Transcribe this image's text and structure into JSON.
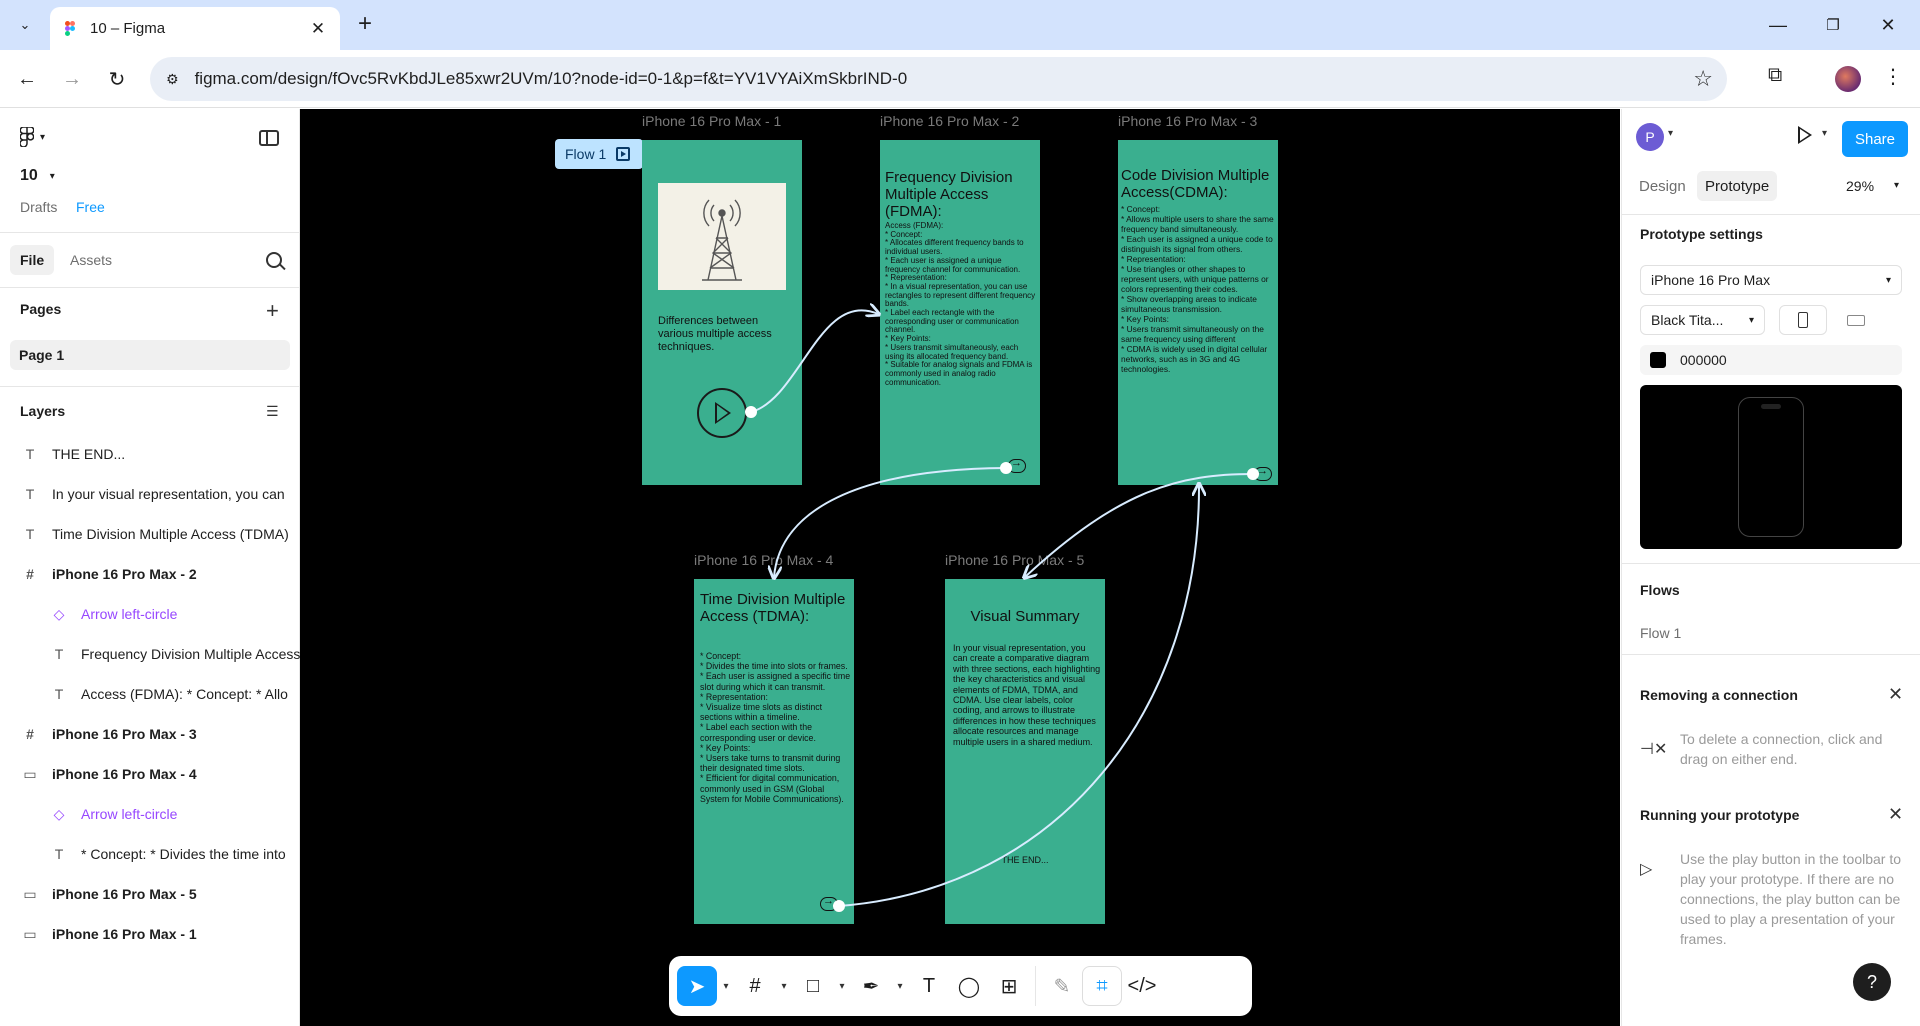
{
  "browser": {
    "tab_title": "10 – Figma",
    "url": "figma.com/design/fOvc5RvKbdJLe85xwr2UVm/10?node-id=0-1&p=f&t=YV1VYAiXmSkbrIND-0"
  },
  "left_panel": {
    "file_name": "10",
    "drafts": "Drafts",
    "plan": "Free",
    "tabs": [
      "File",
      "Assets"
    ],
    "pages_title": "Pages",
    "pages": [
      "Page 1"
    ],
    "layers_title": "Layers",
    "layers": [
      {
        "label": "THE END...",
        "icon": "text-icon"
      },
      {
        "label": "In your visual representation, you can",
        "icon": "text-icon"
      },
      {
        "label": "Time Division Multiple Access (TDMA)",
        "icon": "text-icon"
      },
      {
        "label": "iPhone 16 Pro Max - 2",
        "icon": "frame-icon"
      },
      {
        "label": "Arrow left-circle",
        "icon": "component-icon"
      },
      {
        "label": "Frequency Division Multiple Access",
        "icon": "text-icon"
      },
      {
        "label": "Access (FDMA): * Concept: * Allo",
        "icon": "text-icon"
      },
      {
        "label": "iPhone 16 Pro Max - 3",
        "icon": "frame-icon"
      },
      {
        "label": "iPhone 16 Pro Max - 4",
        "icon": "section-icon"
      },
      {
        "label": "Arrow left-circle",
        "icon": "component-icon"
      },
      {
        "label": "* Concept: * Divides the time into",
        "icon": "text-icon"
      },
      {
        "label": "iPhone 16 Pro Max - 5",
        "icon": "section-icon"
      },
      {
        "label": "iPhone 16 Pro Max - 1",
        "icon": "section-icon"
      }
    ]
  },
  "canvas": {
    "flow_badge": "Flow 1",
    "frames": {
      "f1": {
        "label": "iPhone 16 Pro Max - 1",
        "text": "Differences between various multiple access techniques."
      },
      "f2": {
        "label": "iPhone 16 Pro Max - 2",
        "title": "Frequency Division Multiple Access (FDMA):",
        "body": "Access (FDMA):\n* Concept:\n* Allocates different frequency bands to individual users.\n* Each user is assigned a unique frequency channel for communication.\n* Representation:\n* In a visual representation, you can use rectangles to represent different frequency bands.\n* Label each rectangle with the corresponding user or communication channel.\n* Key Points:\n* Users transmit simultaneously, each using its allocated frequency band.\n* Suitable for analog signals and FDMA is commonly used in analog radio communication."
      },
      "f3": {
        "label": "iPhone 16 Pro Max - 3",
        "title": "Code Division Multiple Access(CDMA):",
        "body": "* Concept:\n* Allows multiple users to share the same frequency band simultaneously.\n* Each user is assigned a unique code to distinguish its signal from others.\n* Representation:\n* Use triangles or other shapes to represent users, with unique patterns or colors representing their codes.\n* Show overlapping areas to indicate simultaneous transmission.\n* Key Points:\n* Users transmit simultaneously on the same frequency using different\n* CDMA is widely used in digital cellular networks, such as in 3G and 4G technologies."
      },
      "f4": {
        "label": "iPhone 16 Pro Max - 4",
        "title": "Time Division Multiple Access (TDMA):",
        "body": "* Concept:\n* Divides the time into slots or frames.\n* Each user is assigned a specific time slot during which it can transmit.\n* Representation:\n* Visualize time slots as distinct sections within a timeline.\n* Label each section with the corresponding user or device.\n* Key Points:\n* Users take turns to transmit during their designated time slots.\n* Efficient for digital communication, commonly used in GSM (Global System for Mobile Communications)."
      },
      "f5": {
        "label": "iPhone 16 Pro Max - 5",
        "title": "Visual Summary",
        "body": "In your visual representation, you can create a comparative diagram with three sections, each highlighting the key characteristics and visual elements of FDMA, TDMA, and CDMA. Use clear labels, color coding, and arrows to illustrate differences in how these techniques allocate resources and manage multiple users in a shared medium.",
        "end": "THE END..."
      }
    }
  },
  "right_panel": {
    "avatar": "P",
    "share": "Share",
    "tabs": [
      "Design",
      "Prototype"
    ],
    "zoom": "29%",
    "prototype_settings": "Prototype settings",
    "device": "iPhone 16 Pro Max",
    "model": "Black Tita...",
    "bg_color_hex": "000000",
    "flows_title": "Flows",
    "flows": [
      "Flow 1"
    ],
    "removing_title": "Removing a connection",
    "removing_text": "To delete a connection, click and drag on either end.",
    "running_title": "Running your prototype",
    "running_text": "Use the play button in the toolbar to play your prototype. If there are no connections, the play button can be used to play a presentation of your frames.",
    "help": "?"
  },
  "colors": {
    "frame_fill": "#3aaf8f",
    "accent": "#0d99ff",
    "component": "#9747ff"
  }
}
